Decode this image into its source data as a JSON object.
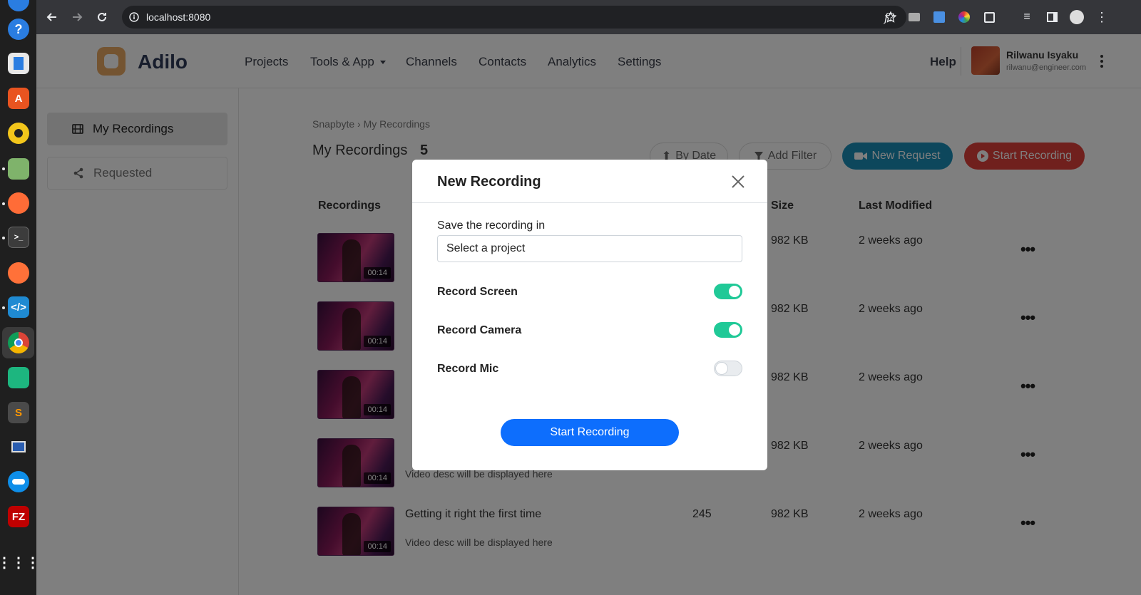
{
  "browser": {
    "url": "localhost:8080"
  },
  "app": {
    "brand": "Adilo",
    "nav": [
      "Projects",
      "Tools & App",
      "Channels",
      "Contacts",
      "Analytics",
      "Settings"
    ],
    "help": "Help",
    "user": {
      "name": "Rilwanu Isyaku",
      "email": "rilwanu@engineer.com"
    }
  },
  "sidebar": {
    "items": [
      {
        "label": "My Recordings",
        "icon": "film-icon",
        "active": true
      },
      {
        "label": "Requested",
        "icon": "share-icon",
        "active": false
      }
    ]
  },
  "main": {
    "breadcrumb": "Snapbyte › My Recordings",
    "title": "My Recordings",
    "count": "5",
    "actions": {
      "sort": "By Date",
      "filter": "Add Filter",
      "new_request": "New Request",
      "start_recording": "Start Recording"
    },
    "columns": {
      "recordings": "Recordings",
      "size": "Size",
      "modified": "Last Modified"
    },
    "rows": [
      {
        "duration": "00:14",
        "title": "",
        "desc": "",
        "views": "",
        "size": "982 KB",
        "modified": "2 weeks ago"
      },
      {
        "duration": "00:14",
        "title": "",
        "desc": "",
        "views": "",
        "size": "982 KB",
        "modified": "2 weeks ago"
      },
      {
        "duration": "00:14",
        "title": "",
        "desc": "",
        "views": "",
        "size": "982 KB",
        "modified": "2 weeks ago"
      },
      {
        "duration": "00:14",
        "title": "",
        "desc": "Video desc will be displayed here",
        "views": "",
        "size": "982 KB",
        "modified": "2 weeks ago"
      },
      {
        "duration": "00:14",
        "title": "Getting it right the first time",
        "desc": "Video desc will be displayed here",
        "views": "245",
        "size": "982 KB",
        "modified": "2 weeks ago"
      }
    ]
  },
  "modal": {
    "title": "New Recording",
    "save_label": "Save the recording in",
    "select_value": "Select a project",
    "toggles": [
      {
        "label": "Record Screen",
        "on": true
      },
      {
        "label": "Record Camera",
        "on": true
      },
      {
        "label": "Record Mic",
        "on": false
      }
    ],
    "start_button": "Start Recording"
  },
  "colors": {
    "accent_teal": "#1a8eb8",
    "accent_red": "#e0403b",
    "primary_blue": "#0d6efd",
    "toggle_on": "#20c997"
  }
}
